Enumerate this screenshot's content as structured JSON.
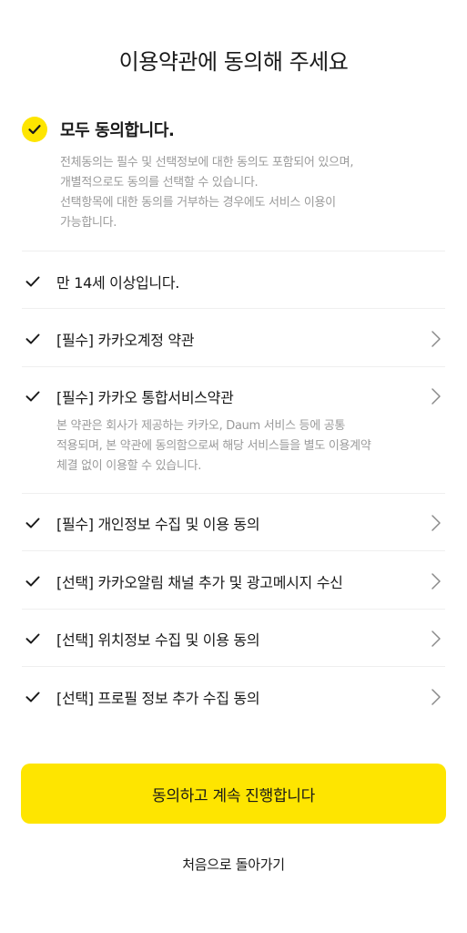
{
  "title": "이용약관에 동의해 주세요",
  "all_agree": {
    "label": "모두 동의합니다.",
    "desc_lines": [
      "전체동의는 필수 및 선택정보에 대한 동의도 포함되어 있으며,",
      "개별적으로도 동의를 선택할 수 있습니다.",
      "선택항목에 대한 동의를 거부하는 경우에도 서비스 이용이",
      "가능합니다."
    ]
  },
  "items": [
    {
      "label": "만 14세 이상입니다."
    },
    {
      "label": "[필수] 카카오계정 약관"
    },
    {
      "label": "[필수] 카카오 통합서비스약관",
      "desc_lines": [
        "본 약관은 회사가 제공하는 카카오, Daum 서비스 등에 공통",
        "적용되며, 본 약관에 동의함으로써 해당 서비스들을 별도 이용계약",
        "체결 없이 이용할 수 있습니다."
      ]
    },
    {
      "label": "[필수] 개인정보 수집 및 이용 동의"
    },
    {
      "label": "[선택] 카카오알림 채널 추가 및 광고메시지 수신"
    },
    {
      "label": "[선택] 위치정보 수집 및 이용 동의"
    },
    {
      "label": "[선택] 프로필 정보 추가 수집 동의"
    }
  ],
  "cta_label": "동의하고 계속 진행합니다",
  "back_label": "처음으로 돌아가기",
  "colors": {
    "accent": "#FEE500",
    "text": "#191919",
    "muted": "#9a9a9a"
  },
  "icons": {
    "check": "checkmark-icon",
    "chevron": "chevron-right-icon"
  }
}
